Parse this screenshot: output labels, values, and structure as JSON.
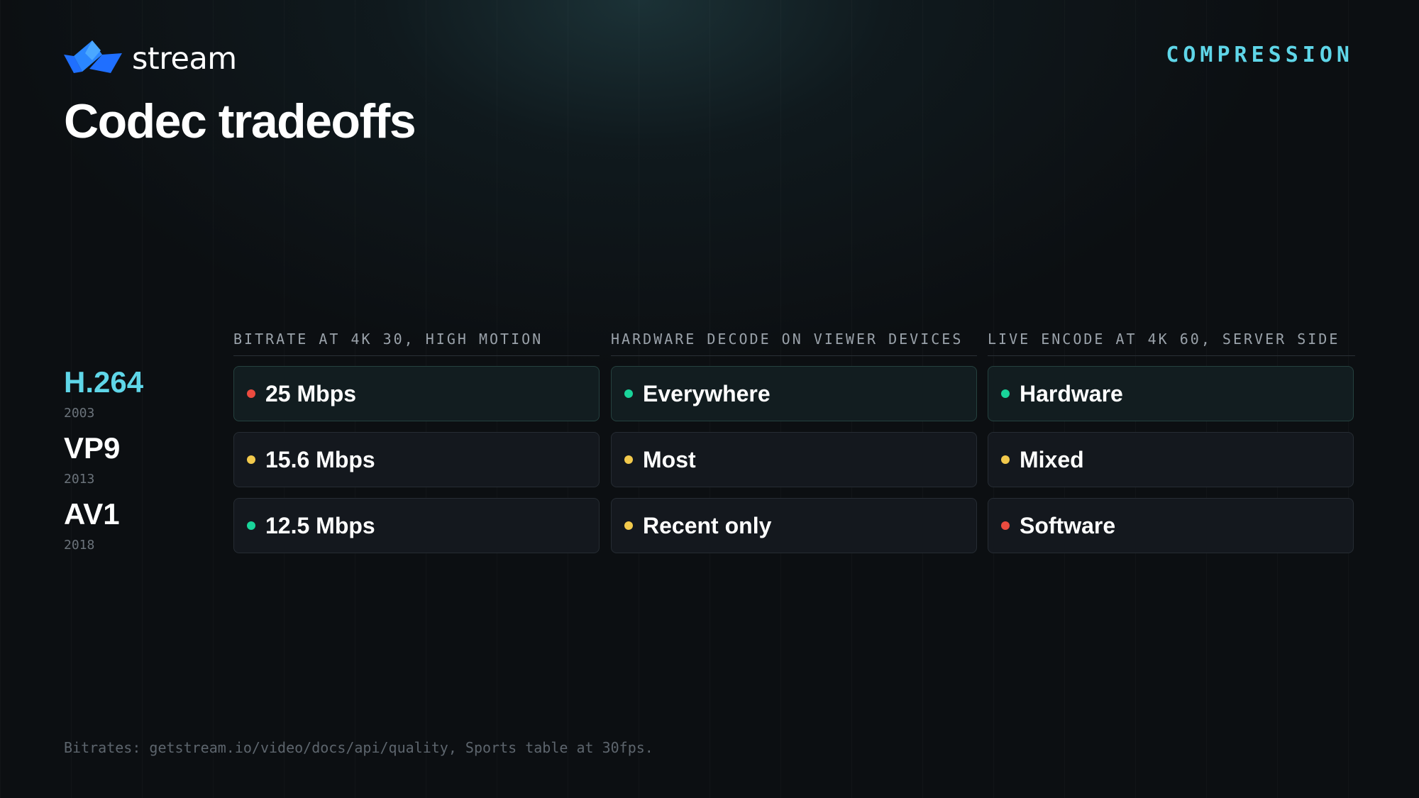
{
  "brand": {
    "name": "stream",
    "logo_colors": [
      "#1f6fff",
      "#3aa0ff"
    ]
  },
  "tag": "COMPRESSION",
  "title": "Codec tradeoffs",
  "columns": [
    "BITRATE AT 4K 30, HIGH MOTION",
    "HARDWARE DECODE ON VIEWER DEVICES",
    "LIVE ENCODE AT 4K 60, SERVER SIDE"
  ],
  "status_colors": {
    "good": "#19d49a",
    "mid": "#f2c94c",
    "bad": "#eb4b3f"
  },
  "rows": [
    {
      "codec": "H.264",
      "year": "2003",
      "highlighted": true,
      "cells": [
        {
          "text": "25 Mbps",
          "status": "bad"
        },
        {
          "text": "Everywhere",
          "status": "good"
        },
        {
          "text": "Hardware",
          "status": "good"
        }
      ]
    },
    {
      "codec": "VP9",
      "year": "2013",
      "highlighted": false,
      "cells": [
        {
          "text": "15.6 Mbps",
          "status": "mid"
        },
        {
          "text": "Most",
          "status": "mid"
        },
        {
          "text": "Mixed",
          "status": "mid"
        }
      ]
    },
    {
      "codec": "AV1",
      "year": "2018",
      "highlighted": false,
      "cells": [
        {
          "text": "12.5 Mbps",
          "status": "good"
        },
        {
          "text": "Recent only",
          "status": "mid"
        },
        {
          "text": "Software",
          "status": "bad"
        }
      ]
    }
  ],
  "footnote": "Bitrates: getstream.io/video/docs/api/quality, Sports table at 30fps."
}
